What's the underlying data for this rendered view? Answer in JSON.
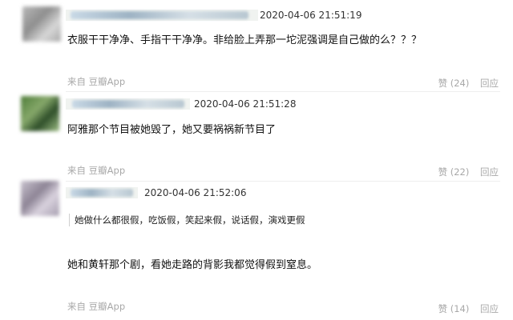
{
  "comments": [
    {
      "timestamp": "2020-04-06 21:51:19",
      "text": "衣服干干净净、手指干干净净。非给脸上弄那一坨泥强调是自己做的么？？？",
      "quote": "",
      "source": "来自 豆瓣App",
      "like_label": "赞 (24)",
      "reply_label": "回应"
    },
    {
      "timestamp": "2020-04-06 21:51:28",
      "text": "阿雅那个节目被她毁了，她又要祸祸新节目了",
      "quote": "",
      "source": "来自 豆瓣App",
      "like_label": "赞 (22)",
      "reply_label": "回应"
    },
    {
      "timestamp": "2020-04-06 21:52:06",
      "text": "她和黄轩那个剧，看她走路的背影我都觉得假到窒息。",
      "quote": "她做什么都很假，吃饭假，笑起来假，说话假，演戏更假",
      "source": "来自 豆瓣App",
      "like_label": "赞 (14)",
      "reply_label": "回应"
    }
  ],
  "colors": {
    "meta_bar": "#f0f3f0",
    "muted_text": "#a8a8a8",
    "body_text": "#111111"
  }
}
